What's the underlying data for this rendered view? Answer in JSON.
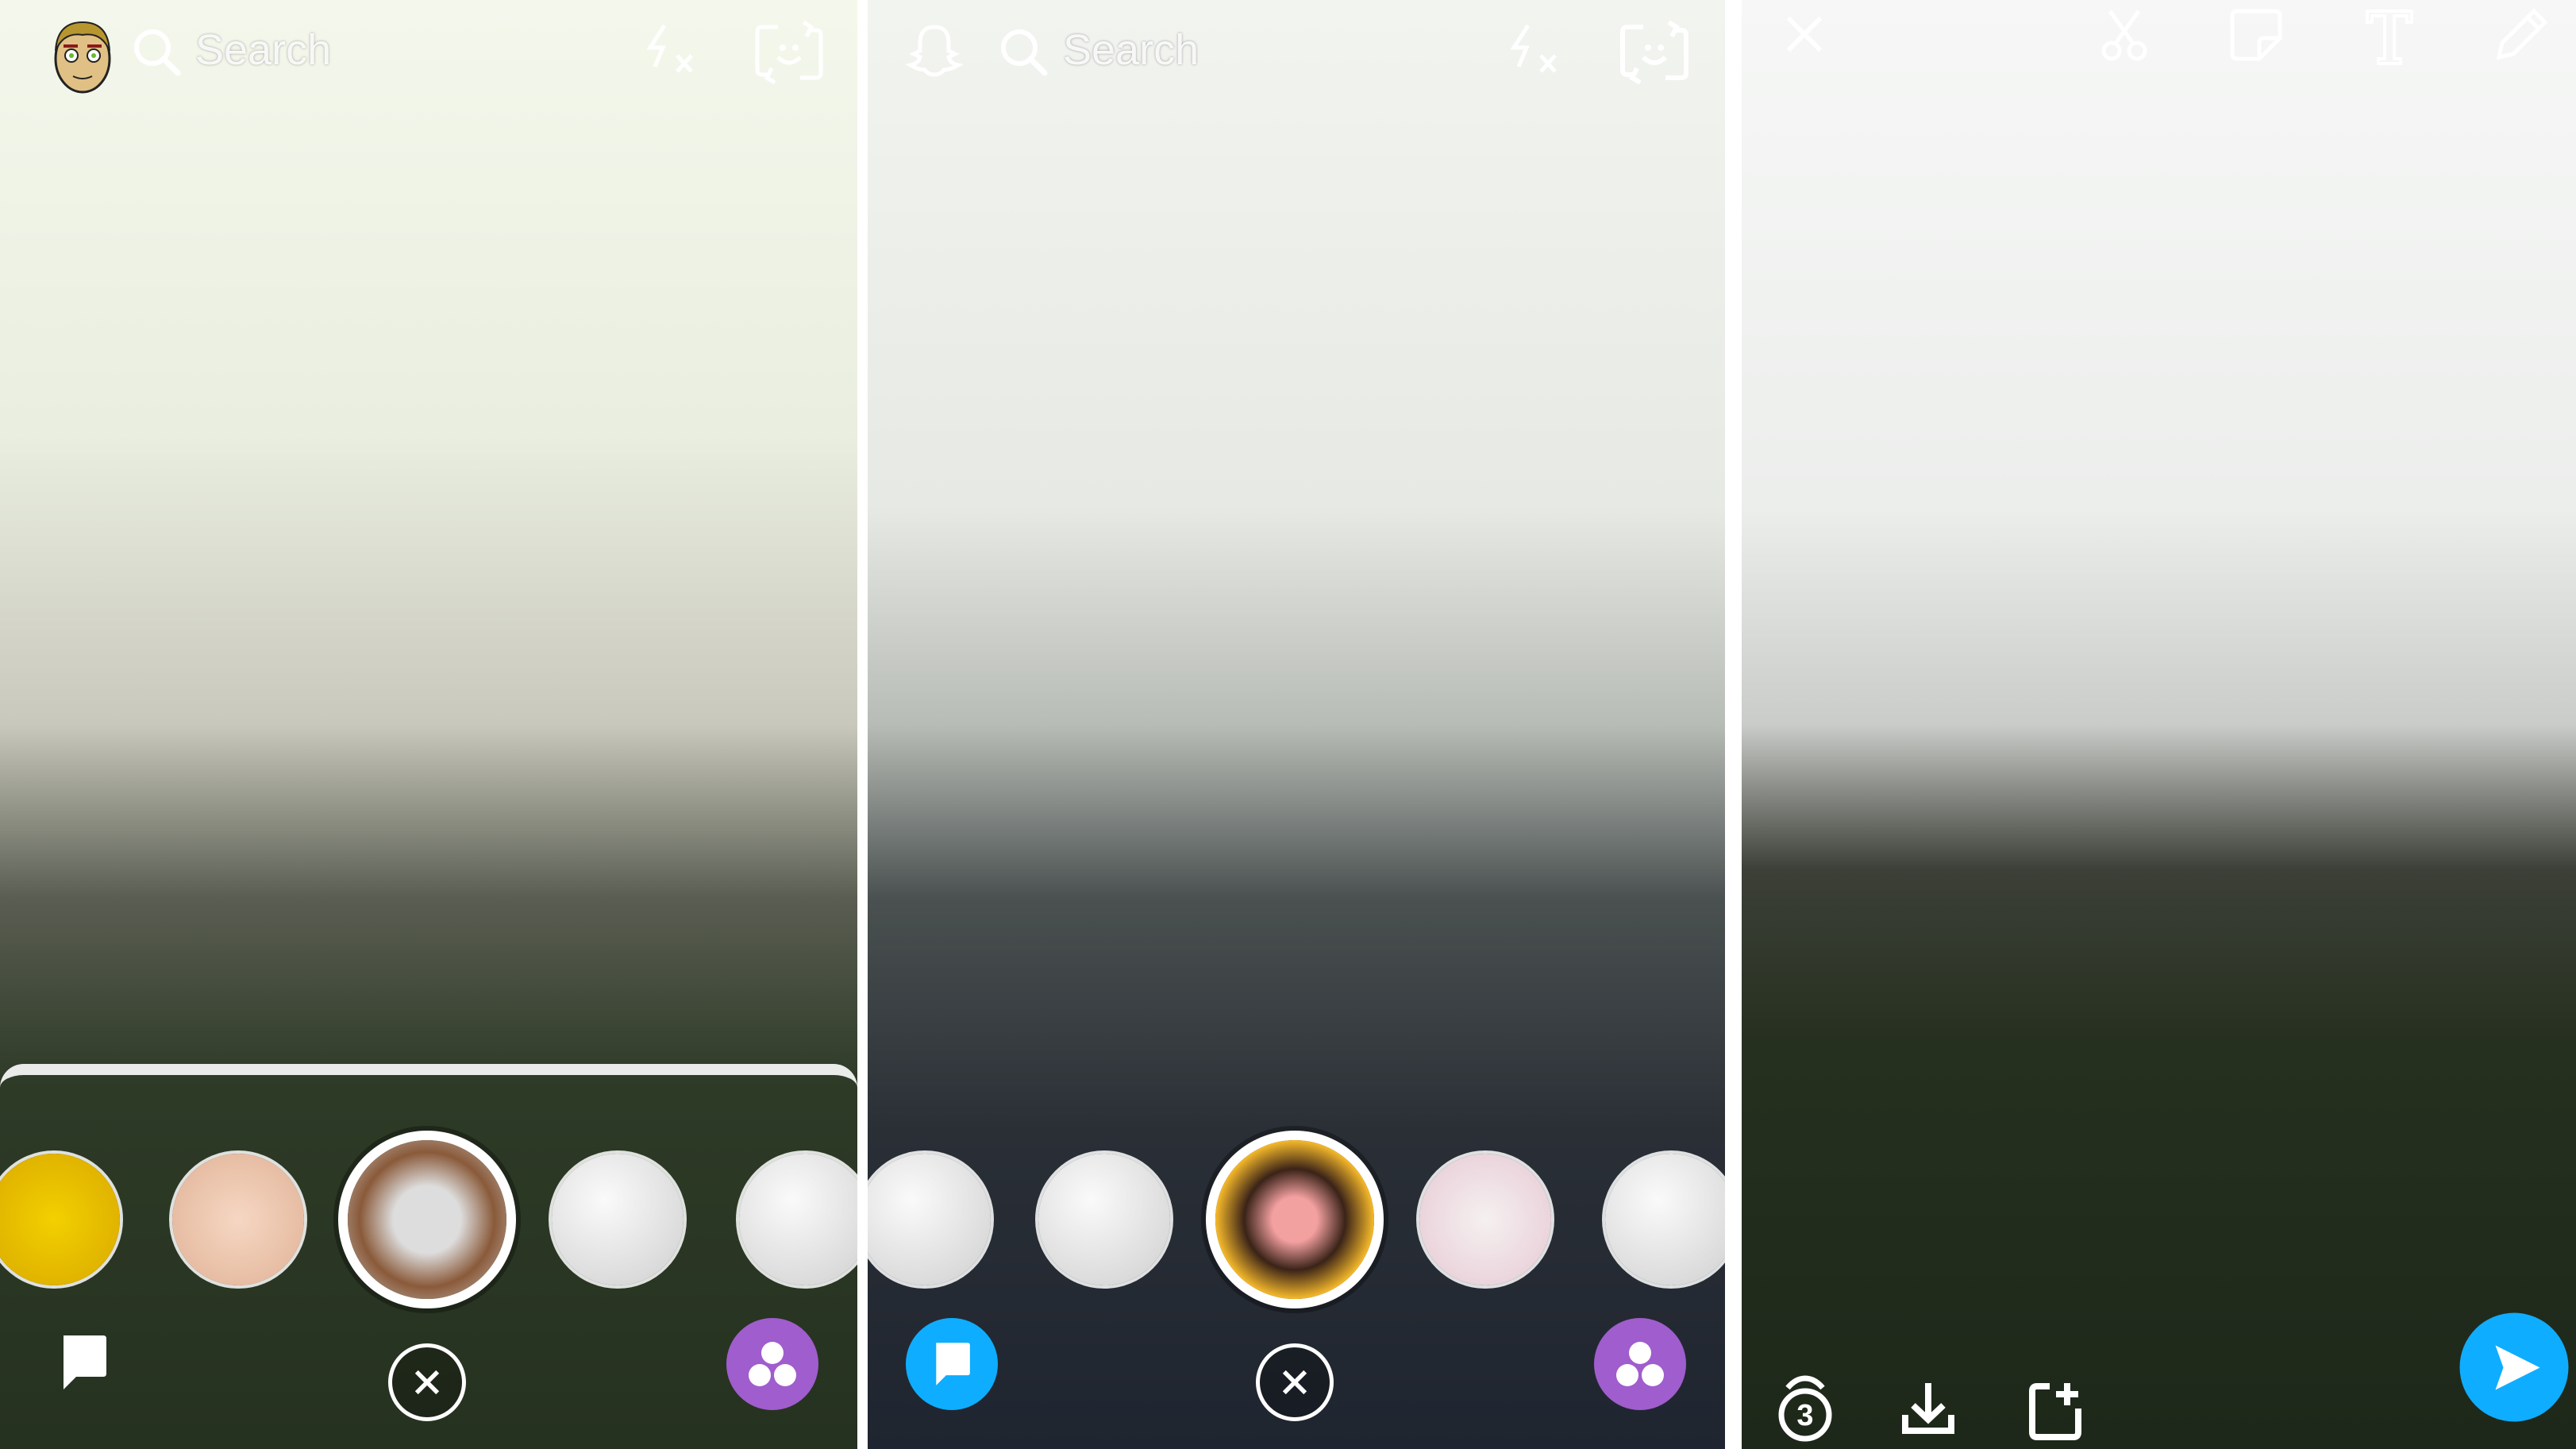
{
  "panels": [
    {
      "id": "lens-camera-1",
      "search_placeholder": "Search",
      "icons": [
        "bitmoji-avatar-icon",
        "search-icon",
        "flash-off-icon",
        "flip-camera-icon",
        "chat-icon",
        "close-icon",
        "lenses-icon"
      ],
      "lenses": [
        "cheetah-lens",
        "hands-lens",
        "horse-lens",
        "smile-face-lens",
        "ghost-face-lens"
      ],
      "selected_lens": "horse-lens"
    },
    {
      "id": "lens-camera-2",
      "search_placeholder": "Search",
      "icons": [
        "ghost-icon",
        "search-icon",
        "flash-off-icon",
        "flip-camera-icon",
        "chat-icon",
        "close-icon",
        "lenses-icon"
      ],
      "lenses": [
        "face-swap-lens",
        "cute-face-lens",
        "hippie-lens",
        "flower-face-lens",
        "crab-face-lens"
      ],
      "selected_lens": "hippie-lens"
    },
    {
      "id": "snap-preview",
      "top_icons": [
        "close-icon",
        "scissors-icon",
        "sticker-icon",
        "text-icon",
        "pencil-icon"
      ],
      "bottom_icons": [
        "timer-icon",
        "download-icon",
        "add-to-story-icon",
        "send-icon"
      ],
      "timer_value": "3"
    }
  ],
  "colors": {
    "chat_blue": "#0fadff",
    "lenses_purple": "#a05dcd",
    "send_blue": "#0fadff",
    "lens_ring": "#ffffff"
  }
}
